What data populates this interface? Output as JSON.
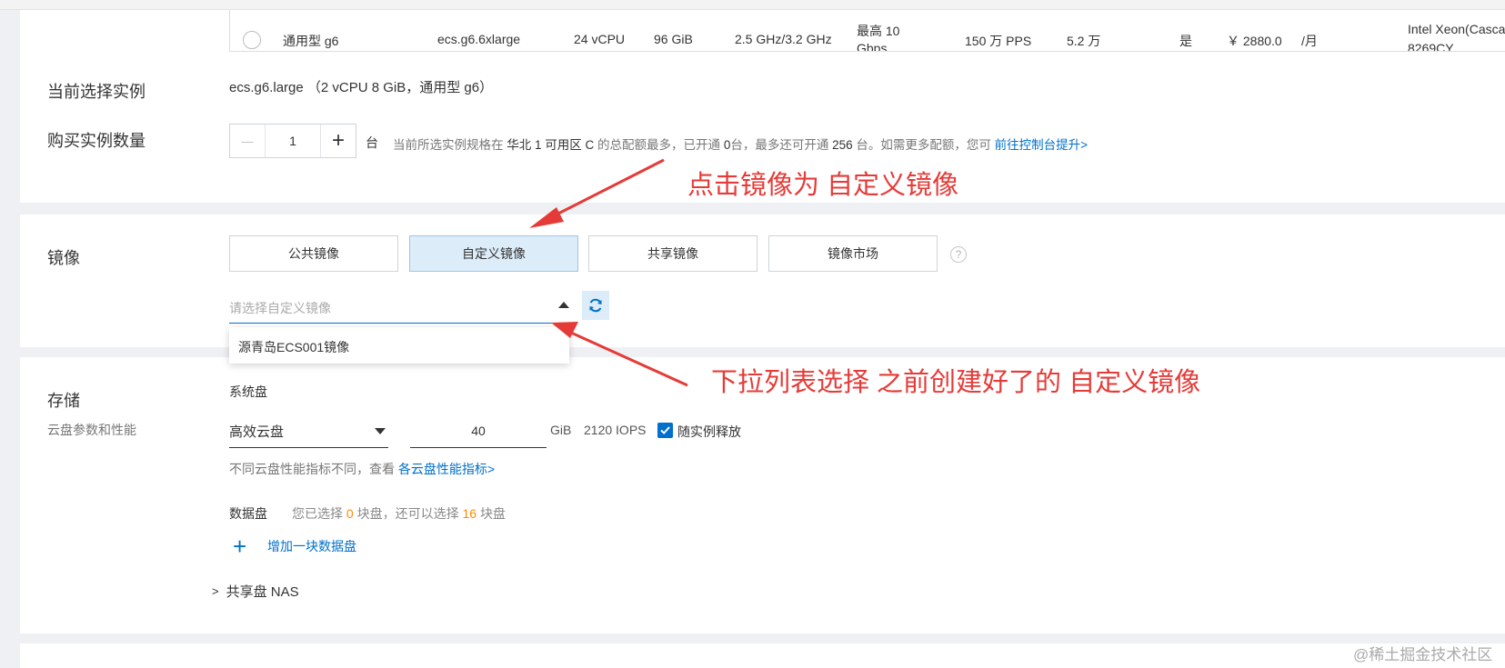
{
  "table_row": {
    "family": "通用型 g6",
    "spec": "ecs.g6.6xlarge",
    "vcpu": "24 vCPU",
    "memory": "96 GiB",
    "clock": "2.5 GHz/3.2 GHz",
    "bandwidth_l1": "最高 10",
    "bandwidth_l2": "Gbps",
    "pps": "150 万 PPS",
    "connections": "5.2 万",
    "ipv6": "是",
    "price": "￥ 2880.0",
    "price_unit": "/月",
    "cpu_l1": "Intel Xeon(Cascade",
    "cpu_l2": "8269CY"
  },
  "current_instance": {
    "label": "当前选择实例",
    "value": "ecs.g6.large （2 vCPU 8 GiB，通用型 g6）"
  },
  "quantity": {
    "label": "购买实例数量",
    "minus": "—",
    "value": "1",
    "plus": "+",
    "unit": "台",
    "note_a": "当前所选实例规格在",
    "note_zone": "华北 1 可用区 C",
    "note_b": "的总配额最多，已开通",
    "note_opened": "0",
    "note_c": "台，最多还可开通",
    "note_max": "256",
    "note_d": "台。如需更多配额，您可",
    "note_link": "前往控制台提升",
    "note_link_arrow": ">"
  },
  "image": {
    "label": "镜像",
    "tabs": [
      "公共镜像",
      "自定义镜像",
      "共享镜像",
      "镜像市场"
    ],
    "active_tab": 1,
    "help": "?",
    "select_placeholder": "请选择自定义镜像",
    "dropdown_option": "源青岛ECS001镜像"
  },
  "storage": {
    "label": "存储",
    "sublabel": "云盘参数和性能",
    "system_disk_label": "系统盘",
    "disk_type": "高效云盘",
    "disk_size": "40",
    "size_unit": "GiB",
    "iops": "2120 IOPS",
    "release_label": "随实例释放",
    "release_checked": true,
    "perf_note": "不同云盘性能指标不同，查看",
    "perf_link": "各云盘性能指标>",
    "data_disk_label": "数据盘",
    "data_note_a": "您已选择",
    "data_selected": "0",
    "data_note_b": "块盘，还可以选择",
    "data_remaining": "16",
    "data_note_c": "块盘",
    "add_plus": "+",
    "add_disk": "增加一块数据盘",
    "nas_chevron": ">",
    "nas_label": "共享盘 NAS"
  },
  "annotations": {
    "top": "点击镜像为 自定义镜像",
    "bottom": "下拉列表选择 之前创建好了的 自定义镜像"
  },
  "watermark": "@稀土掘金技术社区",
  "colors": {
    "accent": "#0070cc",
    "orange": "#ff8a00",
    "annotation_red": "#e53b38",
    "active_tab_bg": "#dcecf8"
  }
}
